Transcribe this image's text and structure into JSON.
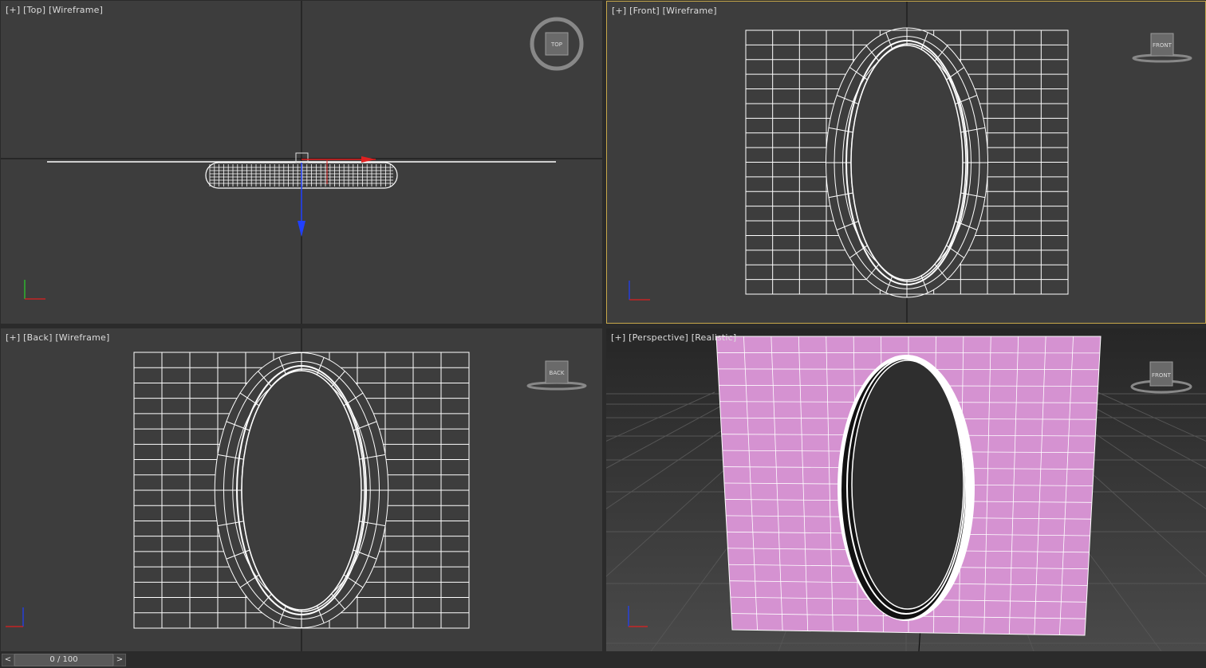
{
  "viewports": {
    "top": {
      "plus": "[+]",
      "view": "[Top]",
      "mode": "[Wireframe]",
      "cube_label": "TOP"
    },
    "front": {
      "plus": "[+]",
      "view": "[Front]",
      "mode": "[Wireframe]",
      "cube_label": "FRONT"
    },
    "back": {
      "plus": "[+]",
      "view": "[Back]",
      "mode": "[Wireframe]",
      "cube_label": "BACK"
    },
    "perspective": {
      "plus": "[+]",
      "view": "[Perspective]",
      "mode": "[Realistic]",
      "cube_label": "FRONT"
    }
  },
  "timeline": {
    "prev": "<",
    "next": ">",
    "frame": "0 / 100"
  },
  "colors": {
    "viewport_bg": "#3d3d3d",
    "active_border": "#c8a84a",
    "wire": "#ffffff",
    "plane_fill": "#d592d1",
    "axis_x": "#e02020",
    "axis_y": "#2bd12b",
    "axis_z": "#2040ff"
  }
}
